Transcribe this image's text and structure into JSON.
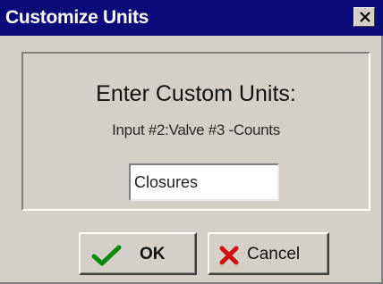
{
  "window": {
    "title": "Customize Units",
    "close_icon": "close-icon"
  },
  "dialog": {
    "heading": "Enter Custom Units:",
    "subtext": "Input #2:Valve #3 -Counts",
    "units_input": {
      "value": "Closures"
    }
  },
  "buttons": {
    "ok": {
      "label": "OK",
      "icon": "checkmark-icon",
      "icon_color": "#0a8a0a"
    },
    "cancel": {
      "label": "Cancel",
      "icon": "x-icon",
      "icon_color": "#d01010"
    }
  },
  "colors": {
    "titlebar": "#0c0a78",
    "face": "#d4d0c8"
  }
}
